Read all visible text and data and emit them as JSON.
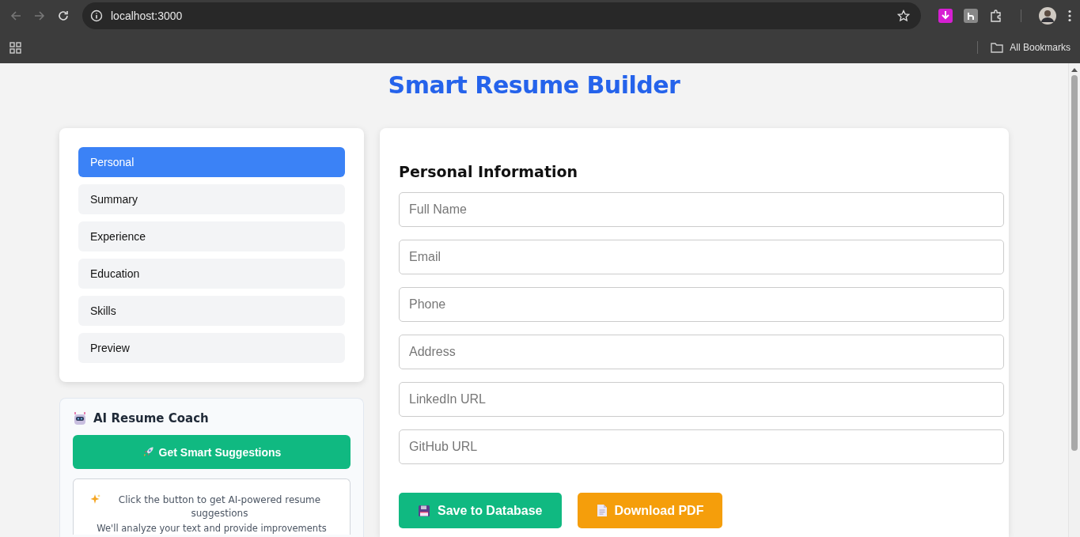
{
  "browser": {
    "url": "localhost:3000",
    "bookmarks": "All Bookmarks"
  },
  "title": "Smart Resume Builder",
  "nav": [
    {
      "label": "Personal",
      "selected": true
    },
    {
      "label": "Summary",
      "selected": false
    },
    {
      "label": "Experience",
      "selected": false
    },
    {
      "label": "Education",
      "selected": false
    },
    {
      "label": "Skills",
      "selected": false
    },
    {
      "label": "Preview",
      "selected": false
    }
  ],
  "coach": {
    "title": "AI Resume Coach",
    "button": "Get Smart Suggestions",
    "hint": "Click the button to get AI-powered resume suggestions",
    "note": "We'll analyze your text and provide improvements"
  },
  "form": {
    "heading": "Personal Information",
    "fields": [
      {
        "placeholder": "Full Name"
      },
      {
        "placeholder": "Email"
      },
      {
        "placeholder": "Phone"
      },
      {
        "placeholder": "Address"
      },
      {
        "placeholder": "LinkedIn URL"
      },
      {
        "placeholder": "GitHub URL"
      }
    ],
    "buttons": [
      {
        "label": "Save to Database",
        "kind": "save"
      },
      {
        "label": "Download PDF",
        "kind": "download"
      }
    ]
  }
}
